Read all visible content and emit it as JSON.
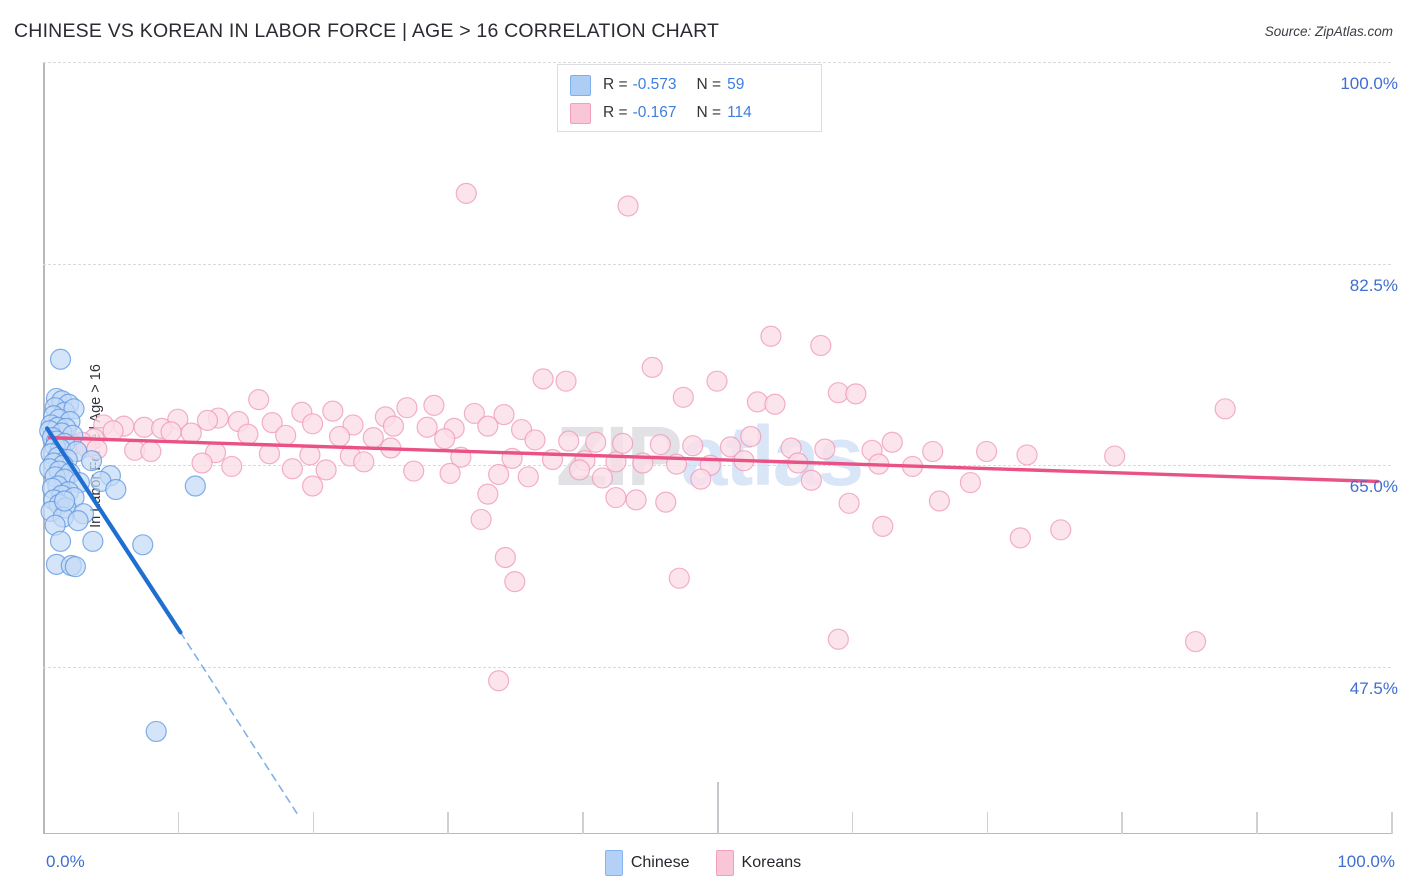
{
  "header": {
    "title": "CHINESE VS KOREAN IN LABOR FORCE | AGE > 16 CORRELATION CHART",
    "source": "Source: ZipAtlas.com"
  },
  "watermark": {
    "part1": "ZIP",
    "part2": "atlas"
  },
  "stats": {
    "chinese": {
      "r_label": "R =",
      "r_value": "-0.573",
      "n_label": "N =",
      "n_value": "59"
    },
    "koreans": {
      "r_label": "R =",
      "r_value": "-0.167",
      "n_label": "N =",
      "n_value": "114"
    }
  },
  "legend": {
    "chinese": "Chinese",
    "koreans": "Koreans"
  },
  "axes": {
    "y_title": "In Labor Force | Age > 16",
    "y_ticks": [
      "100.0%",
      "82.5%",
      "65.0%",
      "47.5%"
    ],
    "x_min": "0.0%",
    "x_max": "100.0%"
  },
  "colors": {
    "chinese_fill": "#c3daf7",
    "chinese_stroke": "#5b94e0",
    "chinese_line": "#1f6fd0",
    "koreans_fill": "#fbdde7",
    "koreans_stroke": "#ef96b7",
    "koreans_line": "#ea5286",
    "axis_label": "#3f6ed0",
    "grid": "#d9d9de"
  },
  "chart_data": {
    "type": "scatter",
    "title": "CHINESE VS KOREAN IN LABOR FORCE | AGE > 16 CORRELATION CHART",
    "xlabel": "",
    "ylabel": "In Labor Force | Age > 16",
    "xlim": [
      0,
      100
    ],
    "ylim": [
      33.0,
      100.0
    ],
    "yticks": [
      47.5,
      65.0,
      82.5,
      100.0
    ],
    "grid": true,
    "legend_position": "bottom-center",
    "series": [
      {
        "name": "Chinese",
        "color": "#c3daf7",
        "R": -0.573,
        "N": 59,
        "trendline": {
          "x0": 0.3,
          "y0": 68.2,
          "x1": 10.2,
          "y1": 50.5,
          "dashed_to_x": 19.0,
          "dashed_to_y": 34.5
        },
        "points": [
          [
            1.3,
            74.2
          ],
          [
            1.0,
            70.8
          ],
          [
            1.4,
            70.6
          ],
          [
            1.9,
            70.3
          ],
          [
            0.9,
            70.0
          ],
          [
            1.6,
            69.6
          ],
          [
            2.3,
            69.9
          ],
          [
            0.8,
            69.3
          ],
          [
            1.2,
            69.0
          ],
          [
            2.0,
            68.8
          ],
          [
            0.6,
            68.5
          ],
          [
            1.1,
            68.3
          ],
          [
            1.7,
            68.2
          ],
          [
            0.5,
            68.0
          ],
          [
            1.4,
            67.8
          ],
          [
            2.2,
            67.6
          ],
          [
            0.7,
            67.4
          ],
          [
            1.0,
            67.1
          ],
          [
            1.6,
            66.9
          ],
          [
            0.9,
            66.6
          ],
          [
            1.3,
            66.4
          ],
          [
            2.5,
            66.2
          ],
          [
            0.6,
            66.0
          ],
          [
            1.1,
            65.7
          ],
          [
            1.8,
            65.5
          ],
          [
            0.8,
            65.2
          ],
          [
            1.5,
            65.0
          ],
          [
            3.6,
            65.4
          ],
          [
            0.5,
            64.7
          ],
          [
            1.2,
            64.5
          ],
          [
            2.0,
            64.3
          ],
          [
            0.9,
            64.0
          ],
          [
            1.6,
            63.8
          ],
          [
            5.0,
            64.1
          ],
          [
            2.7,
            63.5
          ],
          [
            1.1,
            63.2
          ],
          [
            0.7,
            63.0
          ],
          [
            4.3,
            63.6
          ],
          [
            1.9,
            62.7
          ],
          [
            5.4,
            62.9
          ],
          [
            1.4,
            62.4
          ],
          [
            2.3,
            62.2
          ],
          [
            0.8,
            62.0
          ],
          [
            11.3,
            63.2
          ],
          [
            1.2,
            61.6
          ],
          [
            1.7,
            61.3
          ],
          [
            0.6,
            61.0
          ],
          [
            3.0,
            60.8
          ],
          [
            1.5,
            60.5
          ],
          [
            2.6,
            60.2
          ],
          [
            0.9,
            59.8
          ],
          [
            1.3,
            58.4
          ],
          [
            3.7,
            58.4
          ],
          [
            7.4,
            58.1
          ],
          [
            1.0,
            56.4
          ],
          [
            2.1,
            56.3
          ],
          [
            2.4,
            56.2
          ],
          [
            1.6,
            61.9
          ],
          [
            8.4,
            41.9
          ]
        ]
      },
      {
        "name": "Koreans",
        "color": "#fbdde7",
        "R": -0.167,
        "N": 114,
        "trendline": {
          "x0": 0.5,
          "y0": 67.4,
          "x1": 99.0,
          "y1": 63.6
        },
        "points": [
          [
            31.4,
            88.6
          ],
          [
            43.4,
            87.5
          ],
          [
            54.0,
            76.2
          ],
          [
            57.7,
            75.4
          ],
          [
            45.2,
            73.5
          ],
          [
            37.1,
            72.5
          ],
          [
            38.8,
            72.3
          ],
          [
            50.0,
            72.3
          ],
          [
            59.0,
            71.3
          ],
          [
            60.3,
            71.2
          ],
          [
            47.5,
            70.9
          ],
          [
            53.0,
            70.5
          ],
          [
            16.0,
            70.7
          ],
          [
            29.0,
            70.2
          ],
          [
            27.0,
            70.0
          ],
          [
            54.3,
            70.3
          ],
          [
            19.2,
            69.6
          ],
          [
            21.5,
            69.7
          ],
          [
            32.0,
            69.5
          ],
          [
            34.2,
            69.4
          ],
          [
            25.4,
            69.2
          ],
          [
            87.7,
            69.9
          ],
          [
            13.0,
            69.1
          ],
          [
            10.0,
            69.0
          ],
          [
            12.2,
            68.9
          ],
          [
            14.5,
            68.8
          ],
          [
            17.0,
            68.7
          ],
          [
            20.0,
            68.6
          ],
          [
            23.0,
            68.5
          ],
          [
            26.0,
            68.4
          ],
          [
            28.5,
            68.3
          ],
          [
            30.5,
            68.2
          ],
          [
            33.0,
            68.4
          ],
          [
            35.5,
            68.1
          ],
          [
            4.5,
            68.5
          ],
          [
            6.0,
            68.4
          ],
          [
            7.5,
            68.3
          ],
          [
            8.8,
            68.2
          ],
          [
            5.2,
            68.0
          ],
          [
            9.5,
            67.9
          ],
          [
            11.0,
            67.8
          ],
          [
            15.2,
            67.7
          ],
          [
            18.0,
            67.6
          ],
          [
            22.0,
            67.5
          ],
          [
            24.5,
            67.4
          ],
          [
            29.8,
            67.3
          ],
          [
            36.5,
            67.2
          ],
          [
            39.0,
            67.1
          ],
          [
            41.0,
            67.0
          ],
          [
            43.0,
            66.9
          ],
          [
            45.8,
            66.8
          ],
          [
            48.2,
            66.7
          ],
          [
            51.0,
            66.6
          ],
          [
            52.5,
            67.5
          ],
          [
            55.5,
            66.5
          ],
          [
            58.0,
            66.4
          ],
          [
            61.5,
            66.3
          ],
          [
            63.0,
            67.0
          ],
          [
            66.0,
            66.2
          ],
          [
            3.8,
            67.3
          ],
          [
            2.9,
            67.0
          ],
          [
            2.2,
            66.8
          ],
          [
            3.2,
            66.6
          ],
          [
            4.0,
            66.4
          ],
          [
            6.8,
            66.3
          ],
          [
            8.0,
            66.2
          ],
          [
            12.8,
            66.1
          ],
          [
            16.8,
            66.0
          ],
          [
            19.8,
            65.9
          ],
          [
            22.8,
            65.8
          ],
          [
            25.8,
            66.5
          ],
          [
            31.0,
            65.7
          ],
          [
            34.8,
            65.6
          ],
          [
            37.8,
            65.5
          ],
          [
            40.2,
            65.4
          ],
          [
            42.5,
            65.3
          ],
          [
            44.5,
            65.2
          ],
          [
            47.0,
            65.1
          ],
          [
            49.5,
            65.0
          ],
          [
            52.0,
            65.4
          ],
          [
            56.0,
            65.2
          ],
          [
            62.0,
            65.1
          ],
          [
            64.5,
            64.9
          ],
          [
            70.0,
            66.2
          ],
          [
            73.0,
            65.9
          ],
          [
            79.5,
            65.8
          ],
          [
            11.8,
            65.2
          ],
          [
            14.0,
            64.9
          ],
          [
            18.5,
            64.7
          ],
          [
            21.0,
            64.6
          ],
          [
            23.8,
            65.3
          ],
          [
            27.5,
            64.5
          ],
          [
            30.2,
            64.3
          ],
          [
            33.8,
            64.2
          ],
          [
            36.0,
            64.0
          ],
          [
            39.8,
            64.6
          ],
          [
            41.5,
            63.9
          ],
          [
            48.8,
            63.8
          ],
          [
            57.0,
            63.7
          ],
          [
            68.8,
            63.5
          ],
          [
            20.0,
            63.2
          ],
          [
            33.0,
            62.5
          ],
          [
            42.5,
            62.2
          ],
          [
            44.0,
            62.0
          ],
          [
            46.2,
            61.8
          ],
          [
            59.8,
            61.7
          ],
          [
            66.5,
            61.9
          ],
          [
            32.5,
            60.3
          ],
          [
            62.3,
            59.7
          ],
          [
            75.5,
            59.4
          ],
          [
            72.5,
            58.7
          ],
          [
            34.3,
            57.0
          ],
          [
            35.0,
            54.9
          ],
          [
            47.2,
            55.2
          ],
          [
            59.0,
            49.9
          ],
          [
            85.5,
            49.7
          ],
          [
            33.8,
            46.3
          ]
        ]
      }
    ]
  }
}
